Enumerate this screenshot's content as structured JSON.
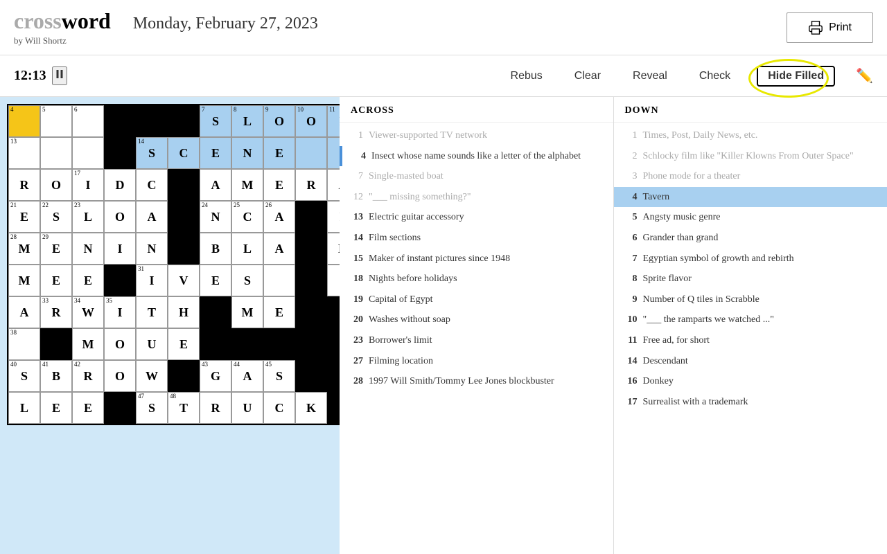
{
  "header": {
    "title": "word",
    "date": "Monday, February 27, 2023",
    "author": "by Will Shortz",
    "print_label": "Print"
  },
  "toolbar": {
    "timer": "12:13",
    "rebus_label": "Rebus",
    "clear_label": "Clear",
    "reveal_label": "Reveal",
    "check_label": "Check",
    "hide_filled_label": "Hide Filled"
  },
  "clues": {
    "across_heading": "ACROSS",
    "down_heading": "DOWN",
    "across": [
      {
        "num": "1",
        "text": "Viewer-supported TV network",
        "dim": true
      },
      {
        "num": "4",
        "text": "Insect whose name sounds like a letter of the alphabet",
        "dim": false,
        "indicator": true
      },
      {
        "num": "7",
        "text": "Single-masted boat",
        "dim": true
      },
      {
        "num": "12",
        "text": "\"___ missing something?\"",
        "dim": true
      },
      {
        "num": "13",
        "text": "Electric guitar accessory",
        "dim": false
      },
      {
        "num": "14",
        "text": "Film sections",
        "dim": false
      },
      {
        "num": "15",
        "text": "Maker of instant pictures since 1948",
        "dim": false
      },
      {
        "num": "18",
        "text": "Nights before holidays",
        "dim": false
      },
      {
        "num": "19",
        "text": "Capital of Egypt",
        "dim": false
      },
      {
        "num": "20",
        "text": "Washes without soap",
        "dim": false
      },
      {
        "num": "23",
        "text": "Borrower's limit",
        "dim": false
      },
      {
        "num": "27",
        "text": "Filming location",
        "dim": false
      },
      {
        "num": "28",
        "text": "1997 Will Smith/Tommy Lee Jones blockbuster",
        "dim": false
      }
    ],
    "down": [
      {
        "num": "1",
        "text": "Times, Post, Daily News, etc.",
        "dim": true
      },
      {
        "num": "2",
        "text": "Schlocky film like \"Killer Klowns From Outer Space\"",
        "dim": true
      },
      {
        "num": "3",
        "text": "Phone mode for a theater",
        "dim": true
      },
      {
        "num": "4",
        "text": "Tavern",
        "dim": false,
        "active": true
      },
      {
        "num": "5",
        "text": "Angsty music genre",
        "dim": false
      },
      {
        "num": "6",
        "text": "Grander than grand",
        "dim": false
      },
      {
        "num": "7",
        "text": "Egyptian symbol of growth and rebirth",
        "dim": false
      },
      {
        "num": "8",
        "text": "Sprite flavor",
        "dim": false
      },
      {
        "num": "9",
        "text": "Number of Q tiles in Scrabble",
        "dim": false
      },
      {
        "num": "10",
        "text": "\"___ the ramparts we watched ...\"",
        "dim": false
      },
      {
        "num": "11",
        "text": "Free ad, for short",
        "dim": false
      },
      {
        "num": "14",
        "text": "Descendant",
        "dim": false
      },
      {
        "num": "16",
        "text": "Donkey",
        "dim": false
      },
      {
        "num": "17",
        "text": "Surrealist with a trademark",
        "dim": false
      }
    ]
  },
  "grid": {
    "rows": [
      [
        "y4",
        "w5",
        "w6",
        "b",
        "b",
        "b",
        "w7",
        "w8",
        "w9",
        "w10",
        "w11"
      ],
      [
        "w13",
        "w",
        "w",
        "b",
        "w14",
        "w",
        "w",
        "w",
        "w",
        "w",
        "w"
      ],
      [
        "w",
        "w",
        "w17",
        "w",
        "w",
        "b",
        "w",
        "w",
        "w",
        "w",
        "w"
      ],
      [
        "w21",
        "w22",
        "w23",
        "w",
        "w",
        "b",
        "w24",
        "w25",
        "w26",
        "b",
        "b"
      ],
      [
        "w28",
        "w29",
        "w",
        "w",
        "w",
        "b",
        "w",
        "w",
        "w",
        "b",
        "w"
      ],
      [
        "w",
        "w",
        "w",
        "b",
        "w31",
        "w",
        "w",
        "w",
        "w",
        "b",
        "w"
      ],
      [
        "w",
        "w33",
        "w34",
        "w35",
        "w",
        "w",
        "b",
        "b",
        "b",
        "b",
        "b"
      ],
      [
        "w38",
        "b",
        "w",
        "w",
        "w",
        "w",
        "b",
        "b",
        "b",
        "b",
        "b"
      ],
      [
        "w40",
        "w41",
        "w42",
        "w",
        "w",
        "b",
        "w43",
        "w44",
        "w45",
        "b",
        "b"
      ],
      [
        "w",
        "w",
        "w",
        "b",
        "w47",
        "w48",
        "w",
        "w",
        "w",
        "w",
        "b"
      ]
    ]
  }
}
